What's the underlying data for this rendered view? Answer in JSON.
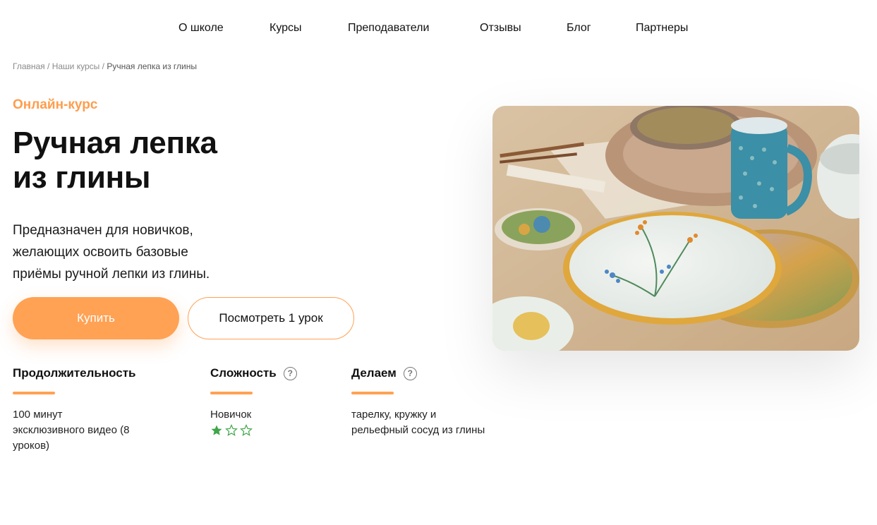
{
  "nav": {
    "items": [
      "О школе",
      "Курсы",
      "Преподаватели",
      "Отзывы",
      "Блог",
      "Партнеры"
    ]
  },
  "breadcrumb": {
    "home": "Главная",
    "separator": "/",
    "courses": "Наши курсы",
    "current": "Ручная лепка из глины"
  },
  "hero": {
    "eyebrow": "Онлайн-курс",
    "title_lines": [
      "Ручная лепка",
      "из глины"
    ],
    "description_lines": [
      "Предназначен для новичков,",
      "желающих освоить базовые",
      "приёмы ручной лепки из глины."
    ],
    "buy_label": "Купить",
    "preview_label": "Посмотреть 1 урок",
    "image_icon": "ceramics-photo"
  },
  "stats": {
    "duration": {
      "title": "Продолжительность",
      "lines": [
        "100 минут",
        "эксклюзивного видео (8",
        "уроков)"
      ]
    },
    "difficulty": {
      "title": "Сложность",
      "help_icon": "question-icon",
      "value": "Новичок",
      "stars_filled": 1,
      "stars_total": 3
    },
    "making": {
      "title": "Делаем",
      "help_icon": "question-icon",
      "lines": [
        "тарелку, кружку и",
        "рельефный сосуд из глины"
      ]
    }
  },
  "colors": {
    "accent": "#ffa254",
    "star": "#3fa64a"
  }
}
